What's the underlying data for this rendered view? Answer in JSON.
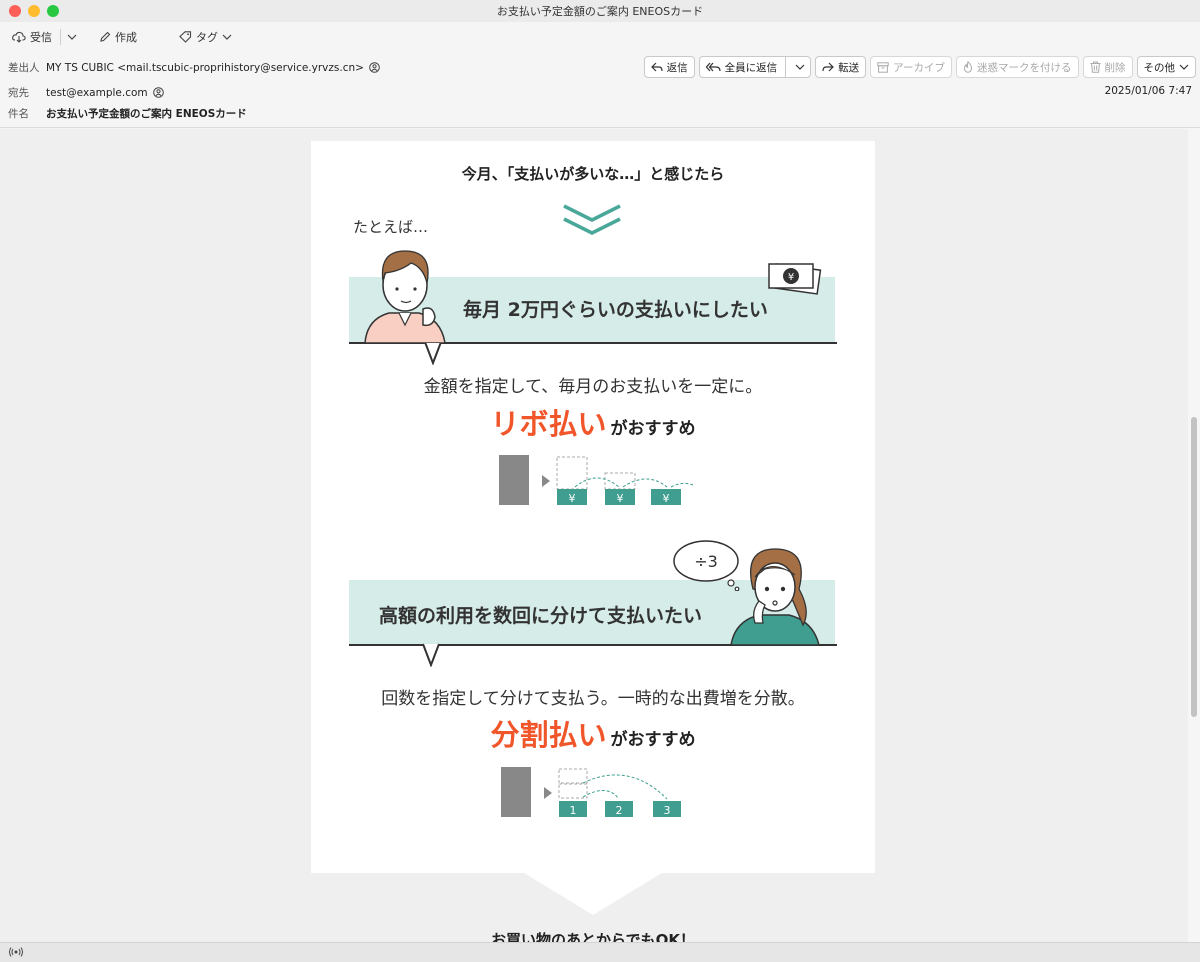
{
  "window": {
    "title": "お支払い予定金額のご案内 ENEOSカード"
  },
  "toolbar": {
    "receive": "受信",
    "compose": "作成",
    "tag": "タグ"
  },
  "header": {
    "from_label": "差出人",
    "from_value": "MY TS CUBIC <mail.tscubic-proprihistory@service.yrvzs.cn>",
    "to_label": "宛先",
    "to_value": "test@example.com",
    "subject_label": "件名",
    "subject_value": "お支払い予定金額のご案内 ENEOSカード",
    "date": "2025/01/06 7:47",
    "buttons": {
      "reply": "返信",
      "reply_all": "全員に返信",
      "forward": "転送",
      "archive": "アーカイブ",
      "junk": "迷惑マークを付ける",
      "delete": "削除",
      "other": "その他"
    }
  },
  "email": {
    "intro": "今月、「支払いが多いな…」と感じたら",
    "example": "たとえば…",
    "case1_heading": "毎月 2万円ぐらいの支払いにしたい",
    "case1_desc": "金額を指定して、毎月のお支払いを一定に。",
    "case1_method": "リボ払い",
    "case1_suffix": "がおすすめ",
    "case2_bubble": "÷3",
    "case2_heading": "高額の利用を数回に分けて支払いたい",
    "case2_desc": "回数を指定して分けて支払う。一時的な出費増を分散。",
    "case2_method": "分割払い",
    "case2_suffix": "がおすすめ",
    "yen": "¥",
    "split_1": "1",
    "split_2": "2",
    "split_3": "3",
    "footer_teaser": "お買い物のあとからでもOK！"
  },
  "colors": {
    "accent_orange": "#f0562a",
    "teal": "#3f9e8f",
    "band": "#d6ece8"
  }
}
